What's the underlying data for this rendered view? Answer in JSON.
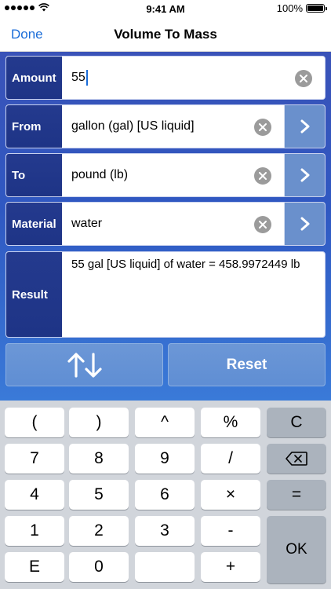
{
  "status": {
    "time": "9:41 AM",
    "battery": "100%",
    "signal_bars": 5
  },
  "nav": {
    "done": "Done",
    "title": "Volume To Mass"
  },
  "form": {
    "amount": {
      "label": "Amount",
      "value": "55"
    },
    "from": {
      "label": "From",
      "value": "gallon (gal) [US liquid]"
    },
    "to": {
      "label": "To",
      "value": "pound (lb)"
    },
    "material": {
      "label": "Material",
      "value": "water"
    },
    "result": {
      "label": "Result",
      "value": "55 gal [US liquid] of water = 458.9972449 lb"
    }
  },
  "actions": {
    "swap_icon": "swap-arrows-icon",
    "reset": "Reset"
  },
  "keyboard": {
    "keys": [
      [
        "(",
        ")",
        "^",
        "%",
        "C"
      ],
      [
        "7",
        "8",
        "9",
        "/",
        "backspace-icon"
      ],
      [
        "4",
        "5",
        "6",
        "×",
        "="
      ],
      [
        "1",
        "2",
        "3",
        "-",
        "OK"
      ],
      [
        "E",
        "0",
        "",
        "+",
        ""
      ]
    ]
  },
  "colors": {
    "accent": "#1a6cd8",
    "label_bg": "#243a8e",
    "chevron_bg": "#6a90cc",
    "button_bg": "#6c97d6"
  }
}
